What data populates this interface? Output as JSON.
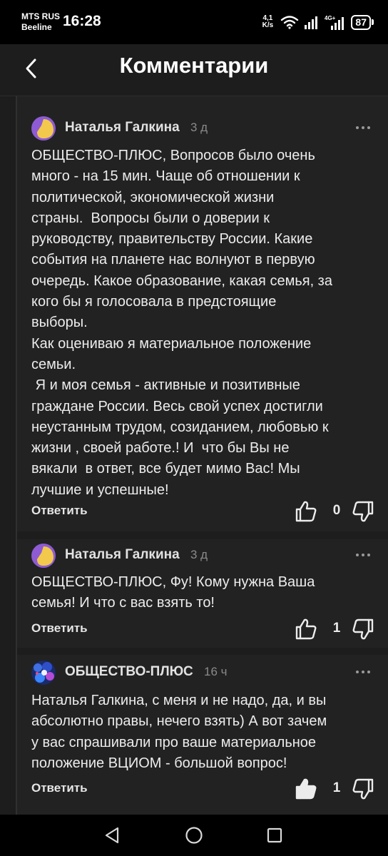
{
  "status_bar": {
    "carrier_name": "MTS RUS",
    "carrier_sub": "Beeline",
    "time": "16:28",
    "net_speed_value": "4,1",
    "net_speed_unit": "K/s",
    "network_type": "4G+",
    "battery": "87"
  },
  "header": {
    "title": "Комментарии",
    "back_icon": "chevron-left-icon"
  },
  "comments": [
    {
      "author": "Наталья Галкина",
      "time_ago": "3 д",
      "text": "ОБЩЕСТВО-ПЛЮС, Вопросов было очень\nмного - на 15 мин. Чаще об отношении к\nполитической, экономической жизни\nстраны.  Вопросы были о доверии к\nруководству, правительству России. Какие\nсобытия на планете нас волнуют в первую\nочередь. Какое образование, какая семья, за\nкого бы я голосовала в предстоящие\nвыборы.\nКак оцениваю я материальное положение\nсемьи.\n Я и моя семья - активные и позитивные\nграждане России. Весь свой успех достигли\nнеустанным трудом, созиданием, любовью к\nжизни , своей работе.! И  что бы Вы не\nвякали  в ответ, все будет мимо Вас! Мы\nлучшие и успешные!",
      "reply_label": "Ответить",
      "likes": "0"
    },
    {
      "author": "Наталья Галкина",
      "time_ago": "3 д",
      "text": "ОБЩЕСТВО-ПЛЮС, Фу! Кому нужна Ваша\nсемья! И что с вас взять то!",
      "reply_label": "Ответить",
      "likes": "1"
    },
    {
      "author": "ОБЩЕСТВО-ПЛЮС",
      "time_ago": "16 ч",
      "text": "Наталья Галкина, с меня и не надо, да, и вы\nабсолютно правы, нечего взять) А вот зачем\nу вас спрашивали про ваше материальное\nположение ВЦИОМ - большой вопрос!",
      "reply_label": "Ответить",
      "likes": "1"
    }
  ],
  "icons": {
    "menu": "more-horizontal-icon",
    "like": "thumbs-up-icon",
    "dislike": "thumbs-down-icon"
  },
  "colors": {
    "background": "#1d1d1d",
    "card": "#222222",
    "avatar_yellow": "#f2c94c",
    "avatar_purple": "#8e5bd4"
  },
  "nav_bar": {
    "back": "triangle-back-icon",
    "home": "circle-home-icon",
    "recents": "square-recents-icon"
  }
}
